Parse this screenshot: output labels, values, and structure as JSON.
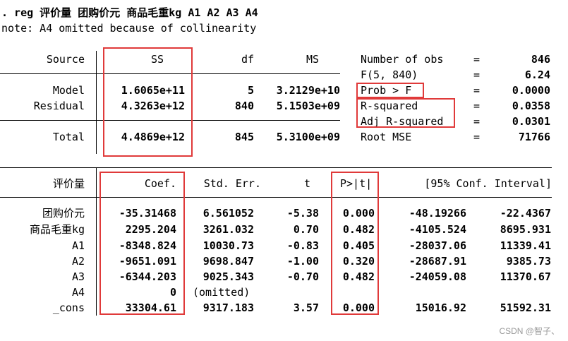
{
  "command": ". reg 评价量 团购价元 商品毛重kg A1 A2 A3 A4",
  "note": "note: A4 omitted because of collinearity",
  "anova": {
    "headers": {
      "source": "Source",
      "ss": "SS",
      "df": "df",
      "ms": "MS"
    },
    "rows": [
      {
        "source": "Model",
        "ss": "1.6065e+11",
        "df": "5",
        "ms": "3.2129e+10"
      },
      {
        "source": "Residual",
        "ss": "4.3263e+12",
        "df": "840",
        "ms": "5.1503e+09"
      },
      {
        "source": "Total",
        "ss": "4.4869e+12",
        "df": "845",
        "ms": "5.3100e+09"
      }
    ]
  },
  "stats": [
    {
      "label": "Number of obs",
      "eq": "=",
      "value": "846"
    },
    {
      "label": "F(5, 840)",
      "eq": "=",
      "value": "6.24"
    },
    {
      "label": "Prob > F",
      "eq": "=",
      "value": "0.0000"
    },
    {
      "label": "R-squared",
      "eq": "=",
      "value": "0.0358"
    },
    {
      "label": "Adj R-squared",
      "eq": "=",
      "value": "0.0301"
    },
    {
      "label": "Root MSE",
      "eq": "=",
      "value": "71766"
    }
  ],
  "coef": {
    "headers": {
      "var": "评价量",
      "coef": "Coef.",
      "se": "Std. Err.",
      "t": "t",
      "p": "P>|t|",
      "ci": "[95% Conf. Interval]"
    },
    "rows": [
      {
        "var": "团购价元",
        "coef": "-35.31468",
        "se": "6.561052",
        "t": "-5.38",
        "p": "0.000",
        "lo": "-48.19266",
        "hi": "-22.4367"
      },
      {
        "var": "商品毛重kg",
        "coef": "2295.204",
        "se": "3261.032",
        "t": "0.70",
        "p": "0.482",
        "lo": "-4105.524",
        "hi": "8695.931"
      },
      {
        "var": "A1",
        "coef": "-8348.824",
        "se": "10030.73",
        "t": "-0.83",
        "p": "0.405",
        "lo": "-28037.06",
        "hi": "11339.41"
      },
      {
        "var": "A2",
        "coef": "-9651.091",
        "se": "9698.847",
        "t": "-1.00",
        "p": "0.320",
        "lo": "-28687.91",
        "hi": "9385.73"
      },
      {
        "var": "A3",
        "coef": "-6344.203",
        "se": "9025.343",
        "t": "-0.70",
        "p": "0.482",
        "lo": "-24059.08",
        "hi": "11370.67"
      },
      {
        "var": "A4",
        "coef": "0",
        "se": "(omitted)",
        "t": "",
        "p": "",
        "lo": "",
        "hi": ""
      },
      {
        "var": "_cons",
        "coef": "33304.61",
        "se": "9317.183",
        "t": "3.57",
        "p": "0.000",
        "lo": "15016.92",
        "hi": "51592.31"
      }
    ]
  },
  "watermark": "CSDN @智子、"
}
